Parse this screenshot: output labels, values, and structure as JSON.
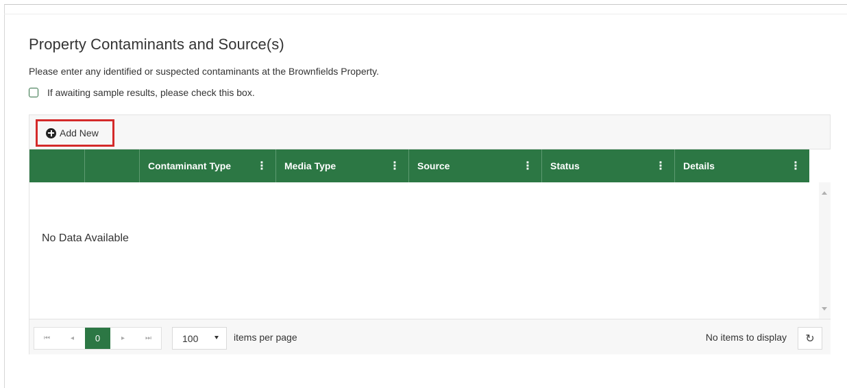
{
  "section": {
    "title": "Property Contaminants and Source(s)",
    "description": "Please enter any identified or suspected contaminants at the Brownfields Property.",
    "checkbox_label": "If awaiting sample results, please check this box.",
    "checkbox_checked": false
  },
  "toolbar": {
    "add_label": "Add New",
    "add_icon": "plus-circle-icon"
  },
  "grid": {
    "columns": [
      {
        "label": ""
      },
      {
        "label": ""
      },
      {
        "label": "Contaminant Type",
        "menu_icon": "⋮"
      },
      {
        "label": "Media Type",
        "menu_icon": "⋮"
      },
      {
        "label": "Source",
        "menu_icon": "⋮"
      },
      {
        "label": "Status",
        "menu_icon": "⋮"
      },
      {
        "label": "Details",
        "menu_icon": "⋮"
      }
    ],
    "empty_text": "No Data Available",
    "header_color": "#2c7744"
  },
  "pager": {
    "first_icon": "⏮",
    "prev_icon": "◂",
    "page": "0",
    "next_icon": "▸",
    "last_icon": "⏭",
    "page_size": "100",
    "items_per_page_label": "items per page",
    "status": "No items to display",
    "refresh_icon": "↻"
  }
}
